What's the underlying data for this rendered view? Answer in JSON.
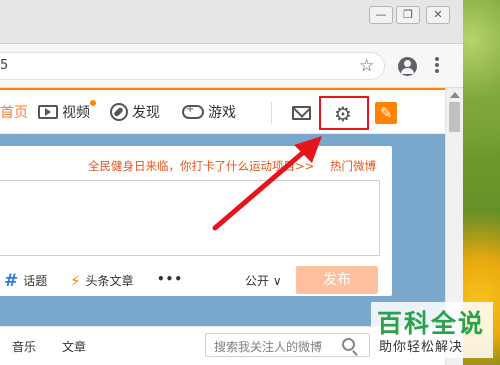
{
  "window": {
    "minimize_glyph": "—",
    "restore_glyph": "❐",
    "close_glyph": "✕"
  },
  "toolbar": {
    "address_text": "5",
    "star_glyph": "☆"
  },
  "nav": {
    "home_label": "首页",
    "video_label": "视频",
    "find_label": "发现",
    "game_label": "游戏",
    "gear_glyph": "⚙",
    "compose_glyph": "✎"
  },
  "publisher": {
    "hot_topic": "全民健身日来临，你打卡了什么运动项目>>",
    "hot_weibo": "热门微博",
    "tools": {
      "topic_label": "话题",
      "article_label": "头条文章",
      "more_label": "•••"
    },
    "visibility": "公开 ∨",
    "publish_label": "发布"
  },
  "tabs": {
    "music": "音乐",
    "article": "文章",
    "search_placeholder": "搜索我关注人的微博"
  },
  "watermark": {
    "title": "百科全说",
    "subtitle": "助你轻松解决"
  },
  "colors": {
    "accent": "#ff8200",
    "highlight": "#e8141b",
    "publish_disabled": "#ffc09f"
  }
}
